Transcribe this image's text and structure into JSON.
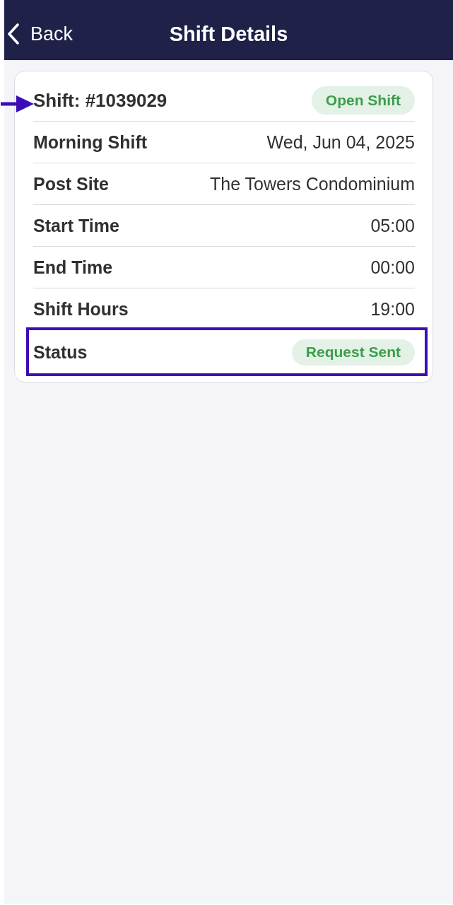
{
  "header": {
    "back_label": "Back",
    "title": "Shift Details"
  },
  "shift": {
    "id_label": "Shift: #1039029",
    "badge": "Open Shift",
    "pointer_arrow": true
  },
  "rows": [
    {
      "label": "Morning Shift",
      "value": "Wed, Jun 04, 2025",
      "kind": "text",
      "highlighted": false
    },
    {
      "label": "Post Site",
      "value": "The Towers Condominium",
      "kind": "text",
      "highlighted": false
    },
    {
      "label": "Start Time",
      "value": "05:00",
      "kind": "text",
      "highlighted": false
    },
    {
      "label": "End Time",
      "value": "00:00",
      "kind": "text",
      "highlighted": false
    },
    {
      "label": "Shift Hours",
      "value": "19:00",
      "kind": "text",
      "highlighted": false
    },
    {
      "label": "Status",
      "value": "Request Sent",
      "kind": "badge",
      "highlighted": true
    }
  ]
}
